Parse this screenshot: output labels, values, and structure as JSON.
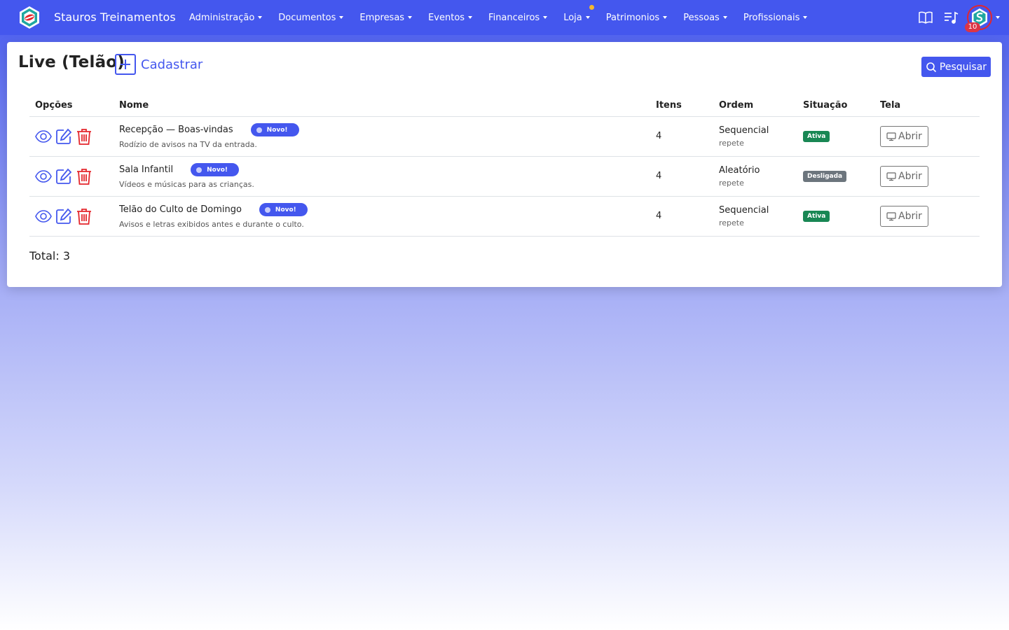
{
  "colors": {
    "primary": "#4457ee",
    "danger": "#dc3545",
    "success": "#198754",
    "secondary": "#6c757d",
    "notification_dot": "#f5b82e"
  },
  "navbar": {
    "brand": "Stauros Treinamentos",
    "menu": [
      {
        "label": "Administração",
        "dot": false
      },
      {
        "label": "Documentos",
        "dot": false
      },
      {
        "label": "Empresas",
        "dot": false
      },
      {
        "label": "Eventos",
        "dot": false
      },
      {
        "label": "Financeiros",
        "dot": false
      },
      {
        "label": "Loja",
        "dot": true
      },
      {
        "label": "Patrimonios",
        "dot": false
      },
      {
        "label": "Pessoas",
        "dot": false
      },
      {
        "label": "Profissionais",
        "dot": false
      }
    ],
    "icons": [
      "book-icon",
      "playlist-icon"
    ],
    "notification_count": "10"
  },
  "page": {
    "title": "Live (Telão)",
    "add_label": "Cadastrar",
    "search_label": "Pesquisar",
    "total_label": "Total: 3"
  },
  "table": {
    "headers": [
      "Opções",
      "Nome",
      "Itens",
      "Ordem",
      "Situação",
      "Tela"
    ],
    "rows": [
      {
        "name": "Recepção — Boas-vindas",
        "badge": "Novo!",
        "description": "Rodízio de avisos na TV da entrada.",
        "items": "4",
        "order": "Sequencial",
        "order_sub": "repete",
        "status": "Ativa",
        "status_color": "#198754",
        "open_label": "Abrir"
      },
      {
        "name": "Sala Infantil",
        "badge": "Novo!",
        "description": "Vídeos e músicas para as crianças.",
        "items": "4",
        "order": "Aleatório",
        "order_sub": "repete",
        "status": "Desligada",
        "status_color": "#6c757d",
        "open_label": "Abrir"
      },
      {
        "name": "Telão do Culto de Domingo",
        "badge": "Novo!",
        "description": "Avisos e letras exibidos antes e durante o culto.",
        "items": "4",
        "order": "Sequencial",
        "order_sub": "repete",
        "status": "Ativa",
        "status_color": "#198754",
        "open_label": "Abrir"
      }
    ]
  }
}
